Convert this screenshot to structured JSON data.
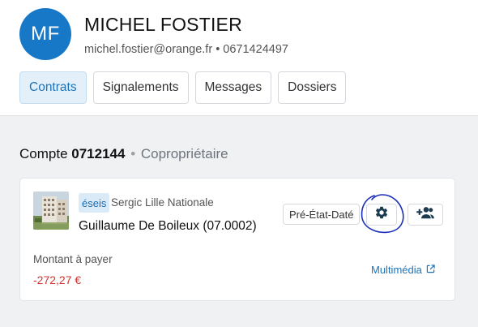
{
  "user": {
    "initials": "MF",
    "name": "MICHEL FOSTIER",
    "contact": "michel.fostier@orange.fr • 0671424497"
  },
  "tabs": [
    {
      "label": "Contrats",
      "active": true
    },
    {
      "label": "Signalements",
      "active": false
    },
    {
      "label": "Messages",
      "active": false
    },
    {
      "label": "Dossiers",
      "active": false
    }
  ],
  "account": {
    "prefix": "Compte",
    "number": "0712144",
    "separator": "•",
    "role": "Copropriétaire"
  },
  "card": {
    "agency_badge": "éseis",
    "agency_name": "Sergic Lille Nationale",
    "owner": "Guillaume De Boileux (07.0002)",
    "pre_etat_date_label": "Pré-État-Daté",
    "gear_icon": "gear-icon",
    "add_person_icon": "person-add-icon",
    "amount_label": "Montant à payer",
    "amount_value": "-272,27 €",
    "multimedia_label": "Multimédia",
    "external_link_icon": "external-link-icon"
  },
  "colors": {
    "avatar": "#1878c8",
    "accent": "#1e73b8",
    "negative": "#d0332e",
    "annotation": "#1a2fb8",
    "icon_dark": "#1d3b4f"
  }
}
